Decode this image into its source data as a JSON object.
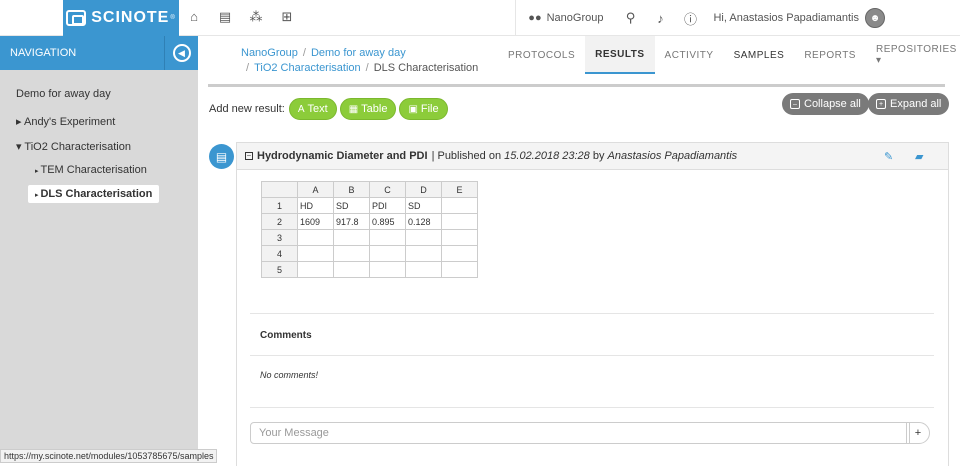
{
  "topbar": {
    "logo_text": "SCINOTE",
    "logo_mark": "®",
    "icons": [
      "home-icon",
      "list-icon",
      "network-icon",
      "sitemap-icon"
    ],
    "team": "NanoGroup",
    "user_greeting": "Hi, Anastasios Papadiamantis"
  },
  "sidebar": {
    "title": "NAVIGATION",
    "items": [
      {
        "label": "Demo for away day"
      },
      {
        "label": "Andy's Experiment"
      },
      {
        "label": "TiO2 Characterisation"
      },
      {
        "label": "TEM Characterisation"
      },
      {
        "label": "DLS Characterisation"
      }
    ]
  },
  "status_url": "https://my.scinote.net/modules/1053785675/samples",
  "breadcrumb": {
    "level1": "NanoGroup",
    "level2": "Demo for away day",
    "level3": "TiO2 Characterisation",
    "current": "DLS Characterisation"
  },
  "tabs": [
    {
      "label": "PROTOCOLS"
    },
    {
      "label": "RESULTS"
    },
    {
      "label": "ACTIVITY"
    },
    {
      "label": "SAMPLES"
    },
    {
      "label": "REPORTS"
    },
    {
      "label": "REPOSITORIES ▾"
    }
  ],
  "toolbar": {
    "add_label": "Add new result:",
    "text_btn": "Text",
    "table_btn": "Table",
    "file_btn": "File",
    "collapse": "Collapse all",
    "expand": "Expand all"
  },
  "result": {
    "title": "Hydrodynamic Diameter and PDI",
    "published_prefix": "| Published on",
    "date": "15.02.2018 23:28",
    "by": "by",
    "author": "Anastasios Papadiamantis",
    "table": {
      "columns": [
        "A",
        "B",
        "C",
        "D",
        "E"
      ],
      "rows": [
        [
          "1",
          "HD",
          "SD",
          "PDI",
          "SD",
          ""
        ],
        [
          "2",
          "1609",
          "917.8",
          "0.895",
          "0.128",
          ""
        ],
        [
          "3",
          "",
          "",
          "",
          "",
          ""
        ],
        [
          "4",
          "",
          "",
          "",
          "",
          ""
        ],
        [
          "5",
          "",
          "",
          "",
          "",
          ""
        ]
      ]
    }
  },
  "comments": {
    "title": "Comments",
    "empty": "No comments!",
    "placeholder": "Your Message",
    "submit": "+"
  },
  "colors": {
    "brand": "#3b96d0",
    "green": "#8ccc3a",
    "grey_button": "#7a7a7a",
    "sidebar": "#d9d9d9"
  }
}
